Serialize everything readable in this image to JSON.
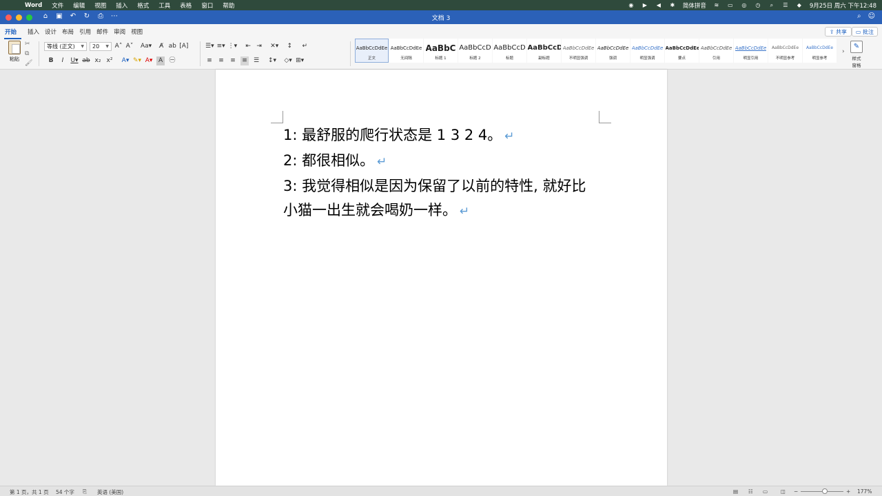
{
  "menubar": {
    "app": "Word",
    "items": [
      "文件",
      "编辑",
      "视图",
      "插入",
      "格式",
      "工具",
      "表格",
      "窗口",
      "帮助"
    ],
    "input_method": "简体拼音",
    "datetime": "9月25日 周六 下午12:48"
  },
  "window": {
    "title": "文档 3"
  },
  "ribbon": {
    "tabs": [
      "开始",
      "插入",
      "设计",
      "布局",
      "引用",
      "邮件",
      "审阅",
      "视图"
    ],
    "active_tab": "开始",
    "share_label": "共享",
    "comment_label": "批注",
    "paste_label": "粘贴",
    "font_name": "等线 (正文)",
    "font_size": "20",
    "styles": [
      {
        "preview": "AaBbCcDdEe",
        "name": "正文"
      },
      {
        "preview": "AaBbCcDdEe",
        "name": "无间隔"
      },
      {
        "preview": "AaBbC",
        "name": "标题 1"
      },
      {
        "preview": "AaBbCcD",
        "name": "标题 2"
      },
      {
        "preview": "AaBbCcD",
        "name": "标题"
      },
      {
        "preview": "AaBbCcD",
        "name": "副标题"
      },
      {
        "preview": "AaBbCcDdEe",
        "name": "不明显强调"
      },
      {
        "preview": "AaBbCcDdEe",
        "name": "强调"
      },
      {
        "preview": "AaBbCcDdEe",
        "name": "明显强调"
      },
      {
        "preview": "AaBbCcDdEe",
        "name": "要点"
      },
      {
        "preview": "AaBbCcDdEe",
        "name": "引用"
      },
      {
        "preview": "AaBbCcDdEe",
        "name": "明显引用"
      },
      {
        "preview": "AaBbCcDdEe",
        "name": "不明显参考"
      },
      {
        "preview": "AaBbCcDdEe",
        "name": "明显参考"
      }
    ],
    "style_pane_label": "样式\n窗格"
  },
  "document": {
    "paragraphs": [
      "1:  最舒服的爬行状态是 1 3 2 4。",
      "2:  都很相似。",
      "3:  我觉得相似是因为保留了以前的特性, 就好比",
      "小猫一出生就会喝奶一样。"
    ],
    "paragraph_mark": "↵"
  },
  "statusbar": {
    "page": "第 1 页，共 1 页",
    "words": "54 个字",
    "language": "英语 (美国)",
    "zoom": "177%"
  },
  "colors": {
    "titlebar": "#2b61b8",
    "menubar": "#2f4a3c",
    "accent": "#1b5fbf"
  }
}
